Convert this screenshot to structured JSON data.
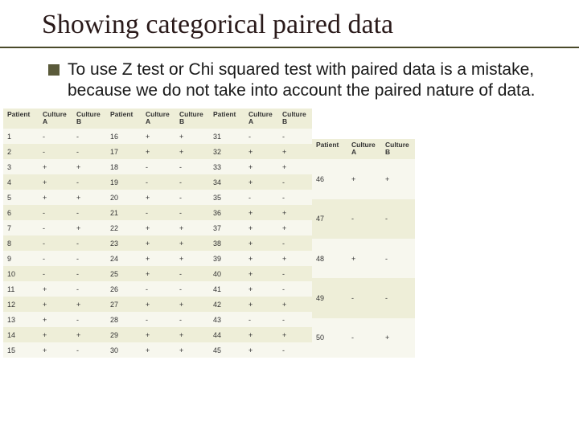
{
  "title": "Showing categorical paired data",
  "bullet": "To use Z test or Chi squared test with paired data is a mistake, because we do not take into account the paired nature of data.",
  "headers": {
    "patient": "Patient",
    "cultureA": "Culture A",
    "cultureB": "Culture B"
  },
  "chart_data": {
    "type": "table",
    "title": "Paired culture results by patient",
    "columns": [
      "Patient",
      "Culture A",
      "Culture B"
    ],
    "rows": [
      {
        "p": 1,
        "a": "-",
        "b": "-"
      },
      {
        "p": 2,
        "a": "-",
        "b": "-"
      },
      {
        "p": 3,
        "a": "+",
        "b": "+"
      },
      {
        "p": 4,
        "a": "+",
        "b": "-"
      },
      {
        "p": 5,
        "a": "+",
        "b": "+"
      },
      {
        "p": 6,
        "a": "-",
        "b": "-"
      },
      {
        "p": 7,
        "a": "-",
        "b": "+"
      },
      {
        "p": 8,
        "a": "-",
        "b": "-"
      },
      {
        "p": 9,
        "a": "-",
        "b": "-"
      },
      {
        "p": 10,
        "a": "-",
        "b": "-"
      },
      {
        "p": 11,
        "a": "+",
        "b": "-"
      },
      {
        "p": 12,
        "a": "+",
        "b": "+"
      },
      {
        "p": 13,
        "a": "+",
        "b": "-"
      },
      {
        "p": 14,
        "a": "+",
        "b": "+"
      },
      {
        "p": 15,
        "a": "+",
        "b": "-"
      },
      {
        "p": 16,
        "a": "+",
        "b": "+"
      },
      {
        "p": 17,
        "a": "+",
        "b": "+"
      },
      {
        "p": 18,
        "a": "-",
        "b": "-"
      },
      {
        "p": 19,
        "a": "-",
        "b": "-"
      },
      {
        "p": 20,
        "a": "+",
        "b": "-"
      },
      {
        "p": 21,
        "a": "-",
        "b": "-"
      },
      {
        "p": 22,
        "a": "+",
        "b": "+"
      },
      {
        "p": 23,
        "a": "+",
        "b": "+"
      },
      {
        "p": 24,
        "a": "+",
        "b": "+"
      },
      {
        "p": 25,
        "a": "+",
        "b": "-"
      },
      {
        "p": 26,
        "a": "-",
        "b": "-"
      },
      {
        "p": 27,
        "a": "+",
        "b": "+"
      },
      {
        "p": 28,
        "a": "-",
        "b": "-"
      },
      {
        "p": 29,
        "a": "+",
        "b": "+"
      },
      {
        "p": 30,
        "a": "+",
        "b": "+"
      },
      {
        "p": 31,
        "a": "-",
        "b": "-"
      },
      {
        "p": 32,
        "a": "+",
        "b": "+"
      },
      {
        "p": 33,
        "a": "+",
        "b": "+"
      },
      {
        "p": 34,
        "a": "+",
        "b": "-"
      },
      {
        "p": 35,
        "a": "-",
        "b": "-"
      },
      {
        "p": 36,
        "a": "+",
        "b": "+"
      },
      {
        "p": 37,
        "a": "+",
        "b": "+"
      },
      {
        "p": 38,
        "a": "+",
        "b": "-"
      },
      {
        "p": 39,
        "a": "+",
        "b": "+"
      },
      {
        "p": 40,
        "a": "+",
        "b": "-"
      },
      {
        "p": 41,
        "a": "+",
        "b": "-"
      },
      {
        "p": 42,
        "a": "+",
        "b": "+"
      },
      {
        "p": 43,
        "a": "-",
        "b": "-"
      },
      {
        "p": 44,
        "a": "+",
        "b": "+"
      },
      {
        "p": 45,
        "a": "+",
        "b": "-"
      },
      {
        "p": 46,
        "a": "+",
        "b": "+"
      },
      {
        "p": 47,
        "a": "-",
        "b": "-"
      },
      {
        "p": 48,
        "a": "+",
        "b": "-"
      },
      {
        "p": 49,
        "a": "-",
        "b": "-"
      },
      {
        "p": 50,
        "a": "-",
        "b": "+"
      }
    ]
  }
}
